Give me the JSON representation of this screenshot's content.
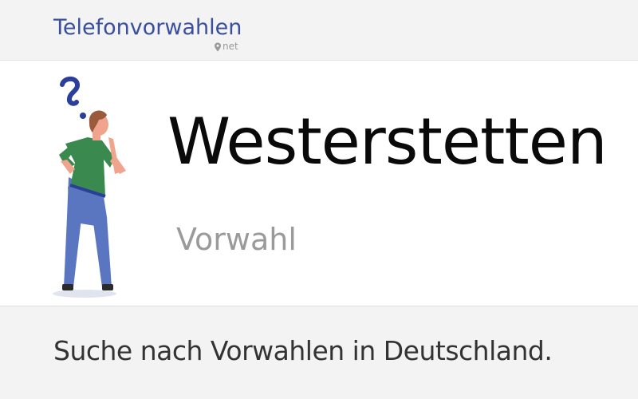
{
  "header": {
    "logo_text": "Telefonvorwahlen",
    "logo_suffix": "net"
  },
  "hero": {
    "title": "Westerstetten",
    "subtitle": "Vorwahl"
  },
  "search": {
    "caption": "Suche nach Vorwahlen in Deutschland."
  },
  "colors": {
    "brand": "#3a4f9c",
    "shirt": "#3a8a4f",
    "pants": "#5b76c0",
    "hair": "#9a5b3c",
    "skin": "#f1a48d"
  }
}
